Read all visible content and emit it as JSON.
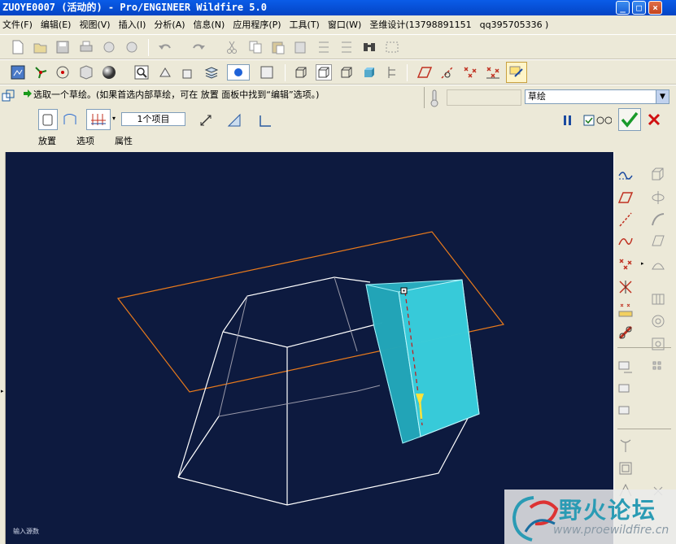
{
  "window": {
    "title": "ZUOYE0007 (活动的) - Pro/ENGINEER Wildfire 5.0",
    "minimize_glyph": "_",
    "maximize_glyph": "□",
    "close_glyph": "×"
  },
  "menubar": {
    "items": [
      "文件(F)",
      "编辑(E)",
      "视图(V)",
      "插入(I)",
      "分析(A)",
      "信息(N)",
      "应用程序(P)",
      "工具(T)",
      "窗口(W)",
      "圣维设计(13798891151",
      "qq395705336 )"
    ]
  },
  "dashboard": {
    "prompt": "选取一个草绘。(如果首选内部草绘，可在 放置 面板中找到“编辑”选项。)",
    "mode_value": "草绘",
    "items_value": "1个项目",
    "tabs": [
      "放置",
      "选项",
      "属性"
    ]
  },
  "viewport": {
    "status_text": "输入源数"
  },
  "watermark": {
    "title": "野火论坛",
    "url": "www.proewildfire.cn"
  },
  "colors": {
    "viewport_bg": "#0d1a3f",
    "wireframe": "#ffffff",
    "sketch_plane": "#e87a1c",
    "preview_solid": "#2ec4d4"
  },
  "icons": [
    "new-icon",
    "open-icon",
    "save-icon",
    "print-icon",
    "undo-icon",
    "redo-icon",
    "cut-icon",
    "copy-icon",
    "paste-icon",
    "regenerate-icon",
    "find-icon",
    "select-icon",
    "repaint-icon",
    "spin-center-icon",
    "orient-icon",
    "shading-icon",
    "zoom-icon",
    "datum-plane-icon",
    "datum-axis-icon",
    "datum-point-icon",
    "coordsys-icon",
    "pause-icon",
    "preview-icon",
    "ok-icon",
    "cancel-icon"
  ]
}
